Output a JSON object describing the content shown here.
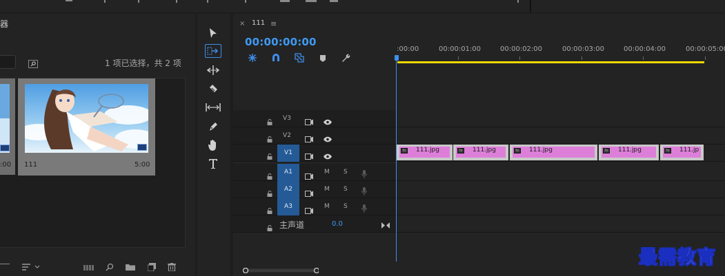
{
  "project_panel": {
    "title": "器",
    "selection_status": "1 项已选择，共 2 项",
    "clip": {
      "name": "111",
      "duration": "5:00"
    },
    "partial_clip_duration": ":00"
  },
  "timeline": {
    "sequence_name": "111",
    "close_glyph": "×",
    "menu_glyph": "≡",
    "timecode": "00:00:00:00",
    "ruler_labels": [
      ":00:00",
      "00:00:01:00",
      "00:00:02:00",
      "00:00:03:00",
      "00:00:04:00",
      "00:00:05:00"
    ],
    "video_tracks": [
      {
        "name": "V3",
        "active": false
      },
      {
        "name": "V2",
        "active": false
      },
      {
        "name": "V1",
        "active": true
      }
    ],
    "audio_tracks": [
      {
        "name": "A1",
        "mute": "M",
        "solo": "S"
      },
      {
        "name": "A2",
        "mute": "M",
        "solo": "S"
      },
      {
        "name": "A3",
        "mute": "M",
        "solo": "S"
      }
    ],
    "master": {
      "label": "主声道",
      "value": "0.0"
    },
    "clips": [
      {
        "name": "111.jpg"
      },
      {
        "name": "111.jpg"
      },
      {
        "name": "111.jpg"
      },
      {
        "name": "111.jpg"
      },
      {
        "name": "111.jp"
      }
    ],
    "fx_label": "fx"
  },
  "tools": [
    "selection-tool",
    "track-select-forward-tool",
    "ripple-edit-tool",
    "razor-tool",
    "slip-tool",
    "pen-tool",
    "hand-tool",
    "type-tool"
  ],
  "watermark": "最需教育",
  "colors": {
    "accent_blue": "#3f9af4",
    "clip_pink": "#dd7fd9",
    "work_area_yellow": "#f0d800",
    "active_track": "#245b97"
  }
}
